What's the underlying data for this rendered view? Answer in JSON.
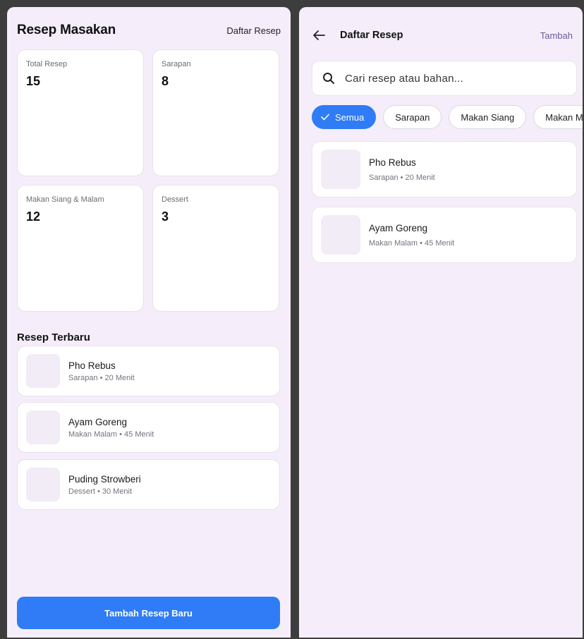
{
  "home": {
    "title": "Resep Masakan",
    "list_link": "Daftar Resep",
    "stats": [
      {
        "label": "Total Resep",
        "value": "15"
      },
      {
        "label": "Sarapan",
        "value": "8"
      },
      {
        "label": "Makan Siang & Malam",
        "value": "12"
      },
      {
        "label": "Dessert",
        "value": "3"
      }
    ],
    "recent_title": "Resep Terbaru",
    "recent": [
      {
        "name": "Pho Rebus",
        "meta": "Sarapan • 20 Menit"
      },
      {
        "name": "Ayam Goreng",
        "meta": "Makan Malam • 45 Menit"
      },
      {
        "name": "Puding Strowberi",
        "meta": "Dessert • 30 Menit"
      }
    ],
    "add_button": "Tambah Resep Baru"
  },
  "list": {
    "title": "Daftar Resep",
    "add_link": "Tambah",
    "search_placeholder": "Cari resep atau bahan...",
    "chips": [
      "Semua",
      "Sarapan",
      "Makan Siang",
      "Makan Malam"
    ],
    "items": [
      {
        "name": "Pho Rebus",
        "meta": "Sarapan • 20 Menit"
      },
      {
        "name": "Ayam Goreng",
        "meta": "Makan Malam • 45 Menit"
      }
    ]
  },
  "icons": {
    "back": "arrow-left-icon",
    "search": "search-icon",
    "check": "check-icon"
  },
  "colors": {
    "accent": "#2f7cf6",
    "background": "#f5eefa",
    "link": "#6b5b9a"
  }
}
